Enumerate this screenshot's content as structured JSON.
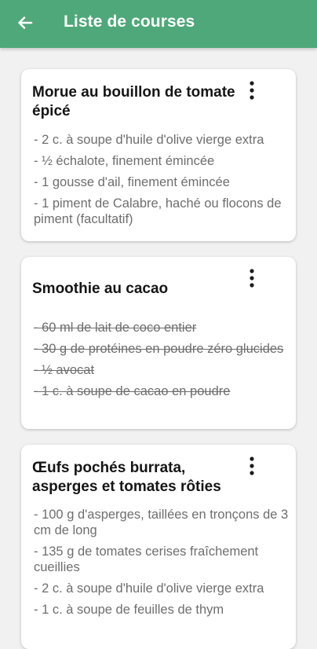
{
  "header": {
    "title": "Liste de courses",
    "back_icon": "arrow-back-icon"
  },
  "recipes": [
    {
      "title": "Morue au bouillon de tomate épicé",
      "checked": false,
      "ingredients": [
        "- 2 c. à soupe d'huile d'olive vierge extra",
        "- ½ échalote, finement émincée",
        "- 1 gousse d'ail, finement émincée",
        "- 1 piment de Calabre, haché ou flocons de piment (facultatif)"
      ]
    },
    {
      "title": "Smoothie au cacao",
      "checked": true,
      "ingredients": [
        "- 60 ml de lait de coco entier",
        "- 30 g de protéines en poudre zéro glucides",
        "- ½ avocat",
        "- 1 c. à soupe de cacao en poudre"
      ]
    },
    {
      "title": "Œufs pochés burrata, asperges et tomates rôties",
      "checked": false,
      "ingredients": [
        "- 100 g d'asperges, taillées en tronçons de 3 cm de long",
        "- 135 g de tomates cerises fraîchement cueillies",
        "- 2 c. à soupe d'huile d'olive vierge extra",
        "- 1 c. à soupe de feuilles de thym"
      ]
    }
  ],
  "colors": {
    "appbar": "#4fa879",
    "background": "#f1f1f1",
    "ingredient_text": "#6e6e6e"
  }
}
